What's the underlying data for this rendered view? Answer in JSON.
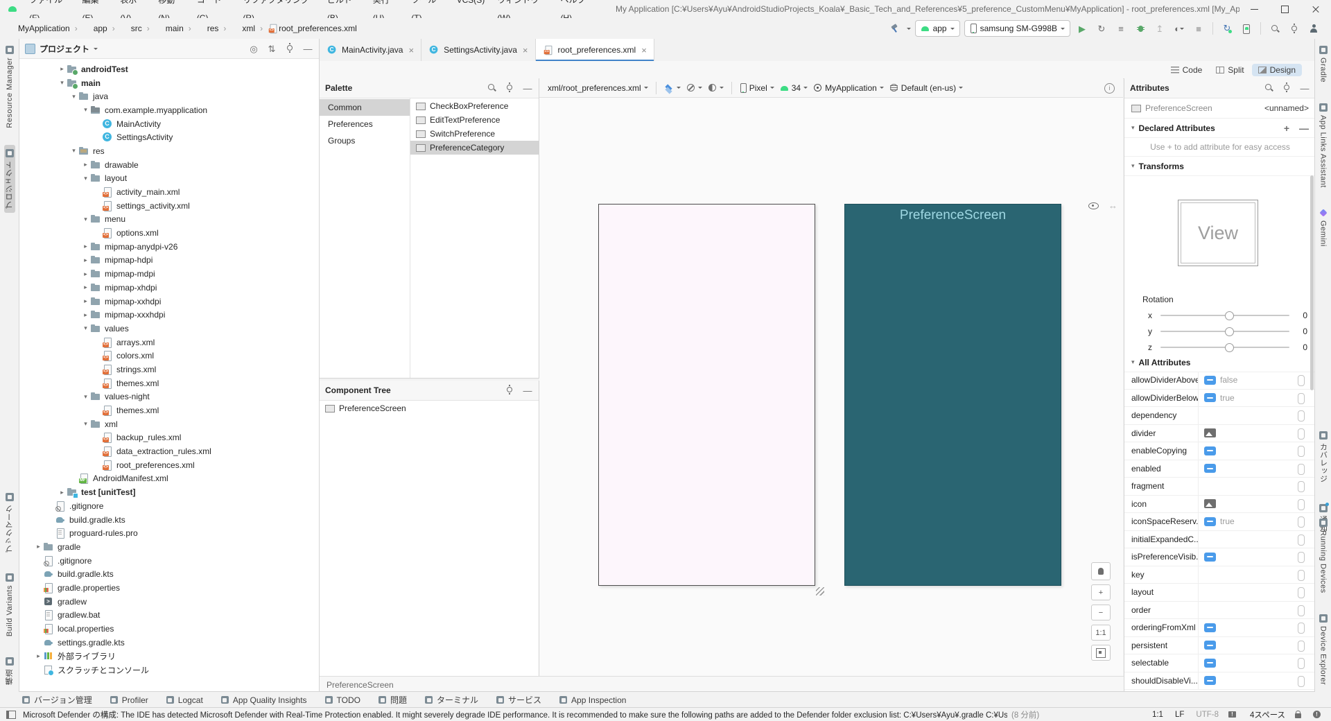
{
  "title_bar": {
    "menus": [
      "ファイル(F)",
      "編集(E)",
      "表示(V)",
      "移動(N)",
      "コード(C)",
      "リファクタリング(R)",
      "ビルド(B)",
      "実行(U)",
      "ツール(T)",
      "VCS(S)",
      "ウィンドウ(W)",
      "ヘルプ(H)"
    ],
    "title": "My Application [C:¥Users¥Ayu¥AndroidStudioProjects_Koala¥_Basic_Tech_and_References¥5_preference_CustomMenu¥MyApplication] - root_preferences.xml [My_Application.app.main]"
  },
  "breadcrumb": {
    "items": [
      {
        "label": "MyApplication",
        "icon": ""
      },
      {
        "label": "app",
        "icon": ""
      },
      {
        "label": "src",
        "icon": ""
      },
      {
        "label": "main",
        "icon": ""
      },
      {
        "label": "res",
        "icon": ""
      },
      {
        "label": "xml",
        "icon": ""
      },
      {
        "label": "root_preferences.xml",
        "icon": "xmlfile"
      }
    ]
  },
  "run_toolbar": {
    "config_label": "app",
    "device_label": "samsung SM-G998B"
  },
  "left_strip": {
    "top": [
      {
        "label": "Resource Manager",
        "icon": "resource-manager",
        "cls": ""
      },
      {
        "label": "プロジェクト",
        "icon": "project",
        "cls": "active"
      }
    ],
    "bottom": [
      {
        "label": "ブックマーク",
        "icon": "bookmarks",
        "cls": ""
      },
      {
        "label": "Build Variants",
        "icon": "build-variants",
        "cls": ""
      },
      {
        "label": "構造",
        "icon": "structure",
        "cls": ""
      }
    ]
  },
  "right_strip": {
    "top": [
      {
        "label": "Gradle",
        "icon": "gradle",
        "cls": ""
      },
      {
        "label": "App Links Assistant",
        "icon": "app-links",
        "cls": ""
      },
      {
        "label": "Gemini",
        "icon": "gemini",
        "cls": ""
      }
    ],
    "middle": [
      {
        "label": "カバレッジ",
        "icon": "coverage",
        "cls": ""
      },
      {
        "label": "通知",
        "icon": "notifications",
        "cls": ""
      }
    ],
    "bottom": [
      {
        "label": "Running Devices",
        "icon": "running-devices",
        "cls": ""
      },
      {
        "label": "Device Explorer",
        "icon": "device-explorer",
        "cls": ""
      }
    ]
  },
  "project_panel": {
    "title": "プロジェクト",
    "tree": [
      {
        "label": "androidTest",
        "depth": 3,
        "chev": "closed",
        "icon": "folder-src",
        "cls": "bold"
      },
      {
        "label": "main",
        "depth": 3,
        "chev": "open",
        "icon": "folder-src",
        "cls": "bold"
      },
      {
        "label": "java",
        "depth": 4,
        "chev": "open",
        "icon": "folder",
        "cls": ""
      },
      {
        "label": "com.example.myapplication",
        "depth": 5,
        "chev": "open",
        "icon": "package",
        "cls": ""
      },
      {
        "label": "MainActivity",
        "depth": 6,
        "chev": "none",
        "icon": "class",
        "cls": ""
      },
      {
        "label": "SettingsActivity",
        "depth": 6,
        "chev": "none",
        "icon": "class",
        "cls": ""
      },
      {
        "label": "res",
        "depth": 4,
        "chev": "open",
        "icon": "folder-res",
        "cls": ""
      },
      {
        "label": "drawable",
        "depth": 5,
        "chev": "closed",
        "icon": "folder",
        "cls": ""
      },
      {
        "label": "layout",
        "depth": 5,
        "chev": "open",
        "icon": "folder",
        "cls": ""
      },
      {
        "label": "activity_main.xml",
        "depth": 6,
        "chev": "none",
        "icon": "xmlfile",
        "cls": ""
      },
      {
        "label": "settings_activity.xml",
        "depth": 6,
        "chev": "none",
        "icon": "xmlfile",
        "cls": ""
      },
      {
        "label": "menu",
        "depth": 5,
        "chev": "open",
        "icon": "folder",
        "cls": ""
      },
      {
        "label": "options.xml",
        "depth": 6,
        "chev": "none",
        "icon": "xmlfile",
        "cls": ""
      },
      {
        "label": "mipmap-anydpi-v26",
        "depth": 5,
        "chev": "closed",
        "icon": "folder",
        "cls": ""
      },
      {
        "label": "mipmap-hdpi",
        "depth": 5,
        "chev": "closed",
        "icon": "folder",
        "cls": ""
      },
      {
        "label": "mipmap-mdpi",
        "depth": 5,
        "chev": "closed",
        "icon": "folder",
        "cls": ""
      },
      {
        "label": "mipmap-xhdpi",
        "depth": 5,
        "chev": "closed",
        "icon": "folder",
        "cls": ""
      },
      {
        "label": "mipmap-xxhdpi",
        "depth": 5,
        "chev": "closed",
        "icon": "folder",
        "cls": ""
      },
      {
        "label": "mipmap-xxxhdpi",
        "depth": 5,
        "chev": "closed",
        "icon": "folder",
        "cls": ""
      },
      {
        "label": "values",
        "depth": 5,
        "chev": "open",
        "icon": "folder",
        "cls": ""
      },
      {
        "label": "arrays.xml",
        "depth": 6,
        "chev": "none",
        "icon": "xmlfile",
        "cls": ""
      },
      {
        "label": "colors.xml",
        "depth": 6,
        "chev": "none",
        "icon": "xmlfile",
        "cls": ""
      },
      {
        "label": "strings.xml",
        "depth": 6,
        "chev": "none",
        "icon": "xmlfile",
        "cls": ""
      },
      {
        "label": "themes.xml",
        "depth": 6,
        "chev": "none",
        "icon": "xmlfile",
        "cls": ""
      },
      {
        "label": "values-night",
        "depth": 5,
        "chev": "open",
        "icon": "folder",
        "cls": ""
      },
      {
        "label": "themes.xml",
        "depth": 6,
        "chev": "none",
        "icon": "xmlfile",
        "cls": ""
      },
      {
        "label": "xml",
        "depth": 5,
        "chev": "open",
        "icon": "folder",
        "cls": ""
      },
      {
        "label": "backup_rules.xml",
        "depth": 6,
        "chev": "none",
        "icon": "xmlfile",
        "cls": ""
      },
      {
        "label": "data_extraction_rules.xml",
        "depth": 6,
        "chev": "none",
        "icon": "xmlfile",
        "cls": ""
      },
      {
        "label": "root_preferences.xml",
        "depth": 6,
        "chev": "none",
        "icon": "xmlfile",
        "cls": ""
      },
      {
        "label": "AndroidManifest.xml",
        "depth": 4,
        "chev": "none",
        "icon": "manifest",
        "cls": ""
      },
      {
        "label": "test [unitTest]",
        "depth": 3,
        "chev": "closed",
        "icon": "folder-test",
        "cls": "bold"
      },
      {
        "label": ".gitignore",
        "depth": 2,
        "chev": "none",
        "icon": "gitignore",
        "cls": ""
      },
      {
        "label": "build.gradle.kts",
        "depth": 2,
        "chev": "none",
        "icon": "gradlefile",
        "cls": ""
      },
      {
        "label": "proguard-rules.pro",
        "depth": 2,
        "chev": "none",
        "icon": "textfile",
        "cls": ""
      },
      {
        "label": "gradle",
        "depth": 1,
        "chev": "closed",
        "icon": "folder",
        "cls": ""
      },
      {
        "label": ".gitignore",
        "depth": 1,
        "chev": "none",
        "icon": "gitignore",
        "cls": ""
      },
      {
        "label": "build.gradle.kts",
        "depth": 1,
        "chev": "none",
        "icon": "gradlefile",
        "cls": ""
      },
      {
        "label": "gradle.properties",
        "depth": 1,
        "chev": "none",
        "icon": "propfile",
        "cls": ""
      },
      {
        "label": "gradlew",
        "depth": 1,
        "chev": "none",
        "icon": "shellfile",
        "cls": ""
      },
      {
        "label": "gradlew.bat",
        "depth": 1,
        "chev": "none",
        "icon": "textfile",
        "cls": ""
      },
      {
        "label": "local.properties",
        "depth": 1,
        "chev": "none",
        "icon": "propfile",
        "cls": ""
      },
      {
        "label": "settings.gradle.kts",
        "depth": 1,
        "chev": "none",
        "icon": "gradlefile",
        "cls": ""
      },
      {
        "label": "外部ライブラリ",
        "depth": 1,
        "chev": "closed",
        "icon": "libicon",
        "cls": ""
      },
      {
        "label": "スクラッチとコンソール",
        "depth": 1,
        "chev": "none",
        "icon": "scratch",
        "cls": ""
      }
    ]
  },
  "editor_tabs": [
    {
      "label": "MainActivity.java",
      "icon": "class",
      "cls": ""
    },
    {
      "label": "SettingsActivity.java",
      "icon": "class",
      "cls": ""
    },
    {
      "label": "root_preferences.xml",
      "icon": "xmlfile",
      "cls": "active"
    }
  ],
  "mode_buttons": [
    {
      "label": "Code",
      "icon": "code",
      "cls": ""
    },
    {
      "label": "Split",
      "icon": "split",
      "cls": ""
    },
    {
      "label": "Design",
      "icon": "design",
      "cls": "active"
    }
  ],
  "palette": {
    "title": "Palette",
    "categories": [
      {
        "label": "Common",
        "cls": "selected"
      },
      {
        "label": "Preferences",
        "cls": ""
      },
      {
        "label": "Groups",
        "cls": ""
      }
    ],
    "items": [
      {
        "label": "CheckBoxPreference",
        "cls": ""
      },
      {
        "label": "EditTextPreference",
        "cls": ""
      },
      {
        "label": "SwitchPreference",
        "cls": ""
      },
      {
        "label": "PreferenceCategory",
        "cls": "selected"
      }
    ]
  },
  "component_tree": {
    "title": "Component Tree",
    "rows": [
      {
        "label": "PreferenceScreen"
      }
    ]
  },
  "design_toolbar": {
    "file": "xml/root_preferences.xml",
    "device": "Pixel",
    "api": "34",
    "theme": "MyApplication",
    "locale": "Default (en-us)"
  },
  "canvas": {
    "blueprint_label": "PreferenceScreen",
    "zoom_fit_label": "1:1",
    "zoom_in_label": "+",
    "zoom_out_label": "−",
    "bottom_breadcrumb": "PreferenceScreen",
    "blueprint_color": "#2a6572",
    "design_bg_color": "#fdf6fc"
  },
  "attributes": {
    "title": "Attributes",
    "component_type": "PreferenceScreen",
    "component_id": "<unnamed>",
    "declared_label": "Declared Attributes",
    "hint": "Use + to add attribute for easy access",
    "transforms_label": "Transforms",
    "view_label": "View",
    "rotation_label": "Rotation",
    "rotation_rows": [
      {
        "axis": "x",
        "value": "0"
      },
      {
        "axis": "y",
        "value": "0"
      },
      {
        "axis": "z",
        "value": "0"
      }
    ],
    "all_label": "All Attributes",
    "toggle_color": "#4a9bea",
    "rows": [
      {
        "name": "allowDividerAbove",
        "widget": "toggle",
        "value": "false"
      },
      {
        "name": "allowDividerBelow",
        "widget": "toggle",
        "value": "true"
      },
      {
        "name": "dependency",
        "widget": "none",
        "value": ""
      },
      {
        "name": "divider",
        "widget": "img",
        "value": ""
      },
      {
        "name": "enableCopying",
        "widget": "toggle",
        "value": ""
      },
      {
        "name": "enabled",
        "widget": "toggle",
        "value": ""
      },
      {
        "name": "fragment",
        "widget": "none",
        "value": ""
      },
      {
        "name": "icon",
        "widget": "img",
        "value": ""
      },
      {
        "name": "iconSpaceReserv...",
        "widget": "toggle",
        "value": "true"
      },
      {
        "name": "initialExpandedC...",
        "widget": "none",
        "value": ""
      },
      {
        "name": "isPreferenceVisib...",
        "widget": "toggle",
        "value": ""
      },
      {
        "name": "key",
        "widget": "none",
        "value": ""
      },
      {
        "name": "layout",
        "widget": "none",
        "value": ""
      },
      {
        "name": "order",
        "widget": "none",
        "value": ""
      },
      {
        "name": "orderingFromXml",
        "widget": "toggle",
        "value": ""
      },
      {
        "name": "persistent",
        "widget": "toggle",
        "value": ""
      },
      {
        "name": "selectable",
        "widget": "toggle",
        "value": ""
      },
      {
        "name": "shouldDisableVi...",
        "widget": "toggle",
        "value": ""
      }
    ]
  },
  "bottom_bar": {
    "items": [
      {
        "label": "バージョン管理"
      },
      {
        "label": "Profiler"
      },
      {
        "label": "Logcat"
      },
      {
        "label": "App Quality Insights"
      },
      {
        "label": "TODO"
      },
      {
        "label": "問題"
      },
      {
        "label": "ターミナル"
      },
      {
        "label": "サービス"
      },
      {
        "label": "App Inspection"
      }
    ]
  },
  "status_bar": {
    "message": "Microsoft Defender の構成: The IDE has detected Microsoft Defender with Real-Time Protection enabled. It might severely degrade IDE performance. It is recommended to make sure the following paths are added to the Defender folder exclusion list: C:¥Users¥Ayu¥.gradle C:¥Users¥Ayu¥AndroidStudio...",
    "time": "(8 分前)",
    "right": [
      {
        "label": "1:1",
        "icon": "",
        "cls": ""
      },
      {
        "label": "LF",
        "icon": "",
        "cls": ""
      },
      {
        "label": "UTF-8",
        "icon": "",
        "cls": "dim"
      },
      {
        "label": "",
        "icon": "alert-icon",
        "cls": ""
      },
      {
        "label": "4スペース",
        "icon": "",
        "cls": ""
      },
      {
        "label": "",
        "icon": "lock-icon",
        "cls": ""
      },
      {
        "label": "",
        "icon": "error-circle-icon",
        "cls": ""
      }
    ]
  }
}
